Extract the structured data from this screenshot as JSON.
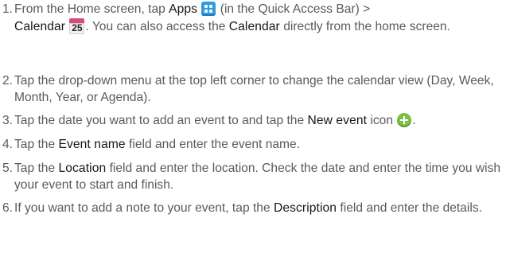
{
  "steps": [
    {
      "number": "1.",
      "t1": "From the Home screen, tap ",
      "apps": "Apps",
      "t2": " (in the Quick Access Bar) >",
      "calendar": "Calendar",
      "t3": ". You can also access the ",
      "calendar2": "Calendar",
      "t4": " directly from the home screen."
    },
    {
      "number": "2.",
      "text": "Tap the drop-down menu at the top left corner to change the calendar view (Day, Week, Month, Year, or Agenda)."
    },
    {
      "number": "3.",
      "t1": "Tap the date you want to add an event to and tap the ",
      "new_event": "New event",
      "t2": " icon",
      "t3": "."
    },
    {
      "number": "4.",
      "t1": "Tap the ",
      "event_name": "Event name",
      "t2": " field and enter the event name."
    },
    {
      "number": "5.",
      "t1": "Tap the ",
      "location": "Location",
      "t2": " field and enter the location. Check the date and enter the time you wish your event to start and finish."
    },
    {
      "number": "6.",
      "t1": "If you want to add a note to your event, tap the ",
      "description": "Description",
      "t2": " field and enter the details."
    }
  ],
  "icons": {
    "apps": "apps-grid-icon",
    "calendar": "calendar-icon",
    "calendar_day": "25",
    "new_event": "plus-circle-icon"
  }
}
